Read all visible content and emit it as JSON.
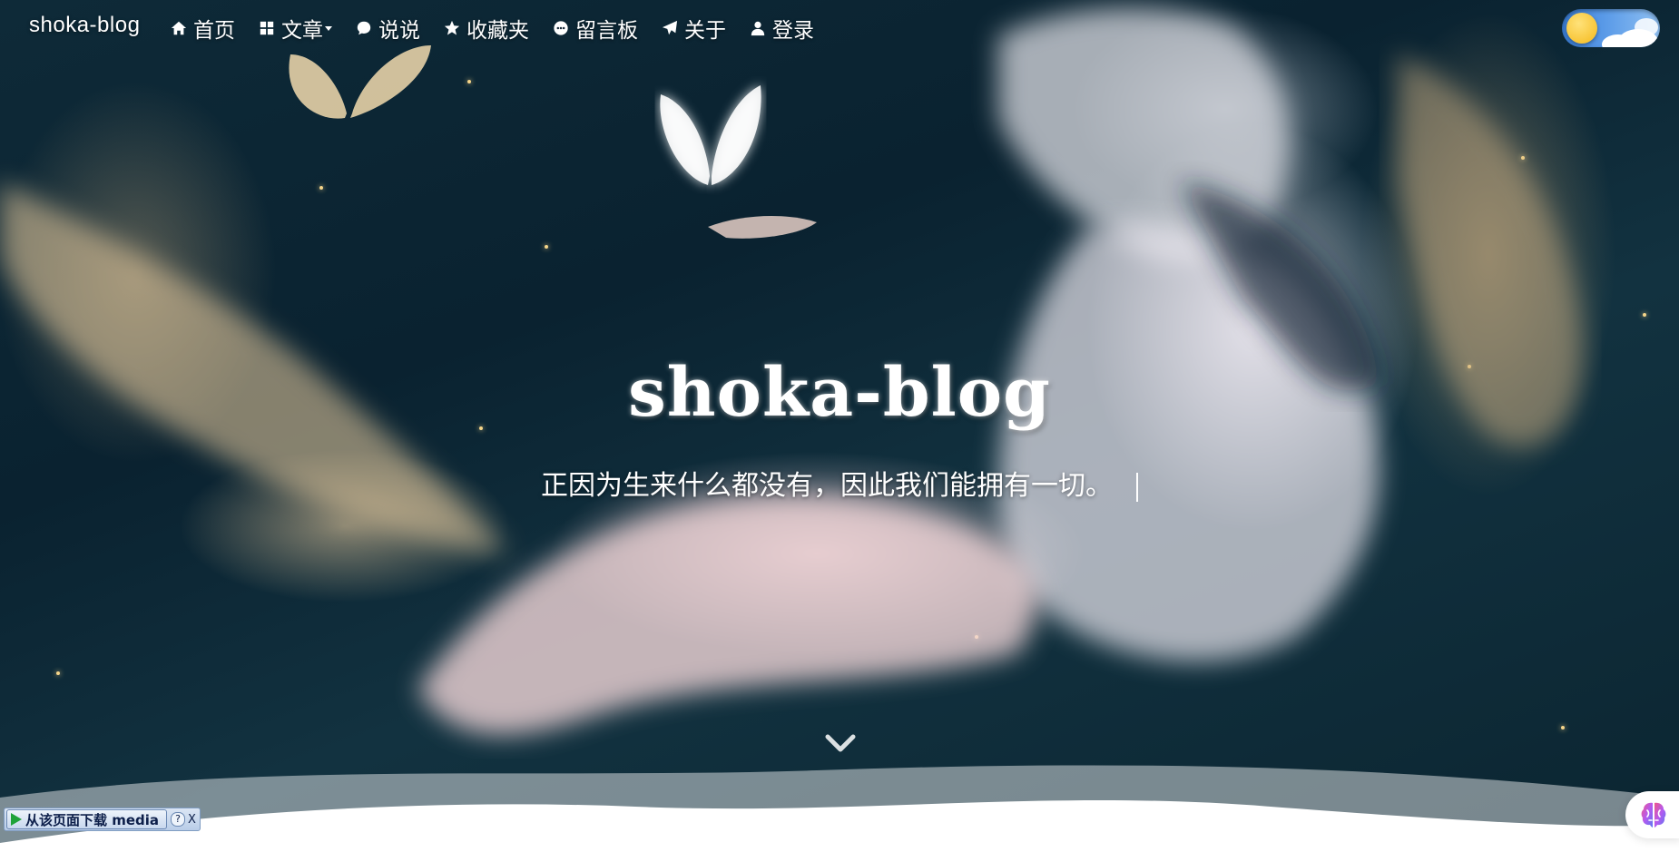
{
  "nav": {
    "brand": "shoka-blog",
    "items": [
      {
        "label": "首页",
        "icon": "home-icon"
      },
      {
        "label": "文章",
        "icon": "grid-icon",
        "has_dropdown": true
      },
      {
        "label": "说说",
        "icon": "chat-icon"
      },
      {
        "label": "收藏夹",
        "icon": "star-icon"
      },
      {
        "label": "留言板",
        "icon": "message-icon"
      },
      {
        "label": "关于",
        "icon": "send-icon"
      },
      {
        "label": "登录",
        "icon": "user-icon"
      }
    ]
  },
  "theme_toggle": {
    "mode": "light",
    "icon": "sun-icon"
  },
  "hero": {
    "title": "shoka-blog",
    "subtitle": "正因为生来什么都没有，因此我们能拥有一切。"
  },
  "download_bar": {
    "label": "从该页面下载 media",
    "help": "?",
    "close": "X"
  },
  "colors": {
    "accent_sun": "#f5b91b",
    "toggle_blue": "#5b9be8",
    "download_play": "#1fa33a"
  }
}
